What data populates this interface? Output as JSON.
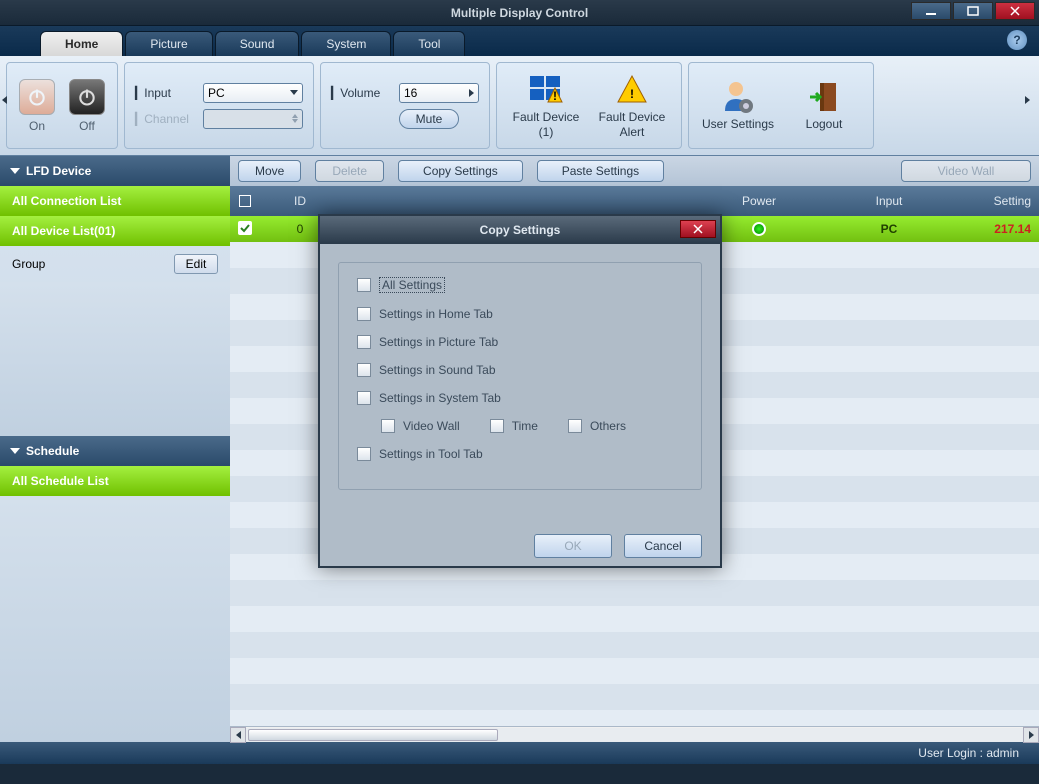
{
  "title": "Multiple Display Control",
  "tabs": {
    "home": "Home",
    "picture": "Picture",
    "sound": "Sound",
    "system": "System",
    "tool": "Tool"
  },
  "ribbon": {
    "on": "On",
    "off": "Off",
    "input_lbl": "Input",
    "input_val": "PC",
    "channel_lbl": "Channel",
    "volume_lbl": "Volume",
    "volume_val": "16",
    "mute": "Mute",
    "fault_device": "Fault Device (1)",
    "fault_alert": "Fault Device Alert",
    "user_settings": "User Settings",
    "logout": "Logout"
  },
  "sidebar": {
    "lfd": "LFD Device",
    "all_conn": "All Connection List",
    "all_dev": "All Device List(01)",
    "group": "Group",
    "edit": "Edit",
    "schedule": "Schedule",
    "all_sched": "All Schedule List"
  },
  "toolbar": {
    "move": "Move",
    "delete": "Delete",
    "copy": "Copy Settings",
    "paste": "Paste Settings",
    "videowall": "Video Wall"
  },
  "grid": {
    "hdr_id": "ID",
    "hdr_power": "Power",
    "hdr_input": "Input",
    "hdr_setting": "Setting",
    "row_id": "0",
    "row_input": "PC",
    "row_setting": "217.14"
  },
  "dialog": {
    "title": "Copy Settings",
    "all": "All Settings",
    "home": "Settings in Home Tab",
    "picture": "Settings in Picture Tab",
    "sound": "Settings in Sound Tab",
    "system": "Settings in System Tab",
    "videowall": "Video Wall",
    "time": "Time",
    "others": "Others",
    "tool": "Settings in Tool Tab",
    "ok": "OK",
    "cancel": "Cancel"
  },
  "status": "User Login : admin"
}
